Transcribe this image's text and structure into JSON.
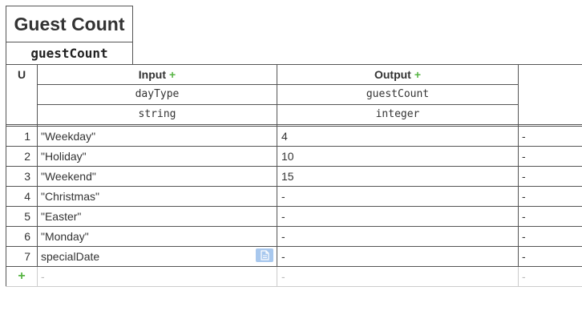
{
  "decision": {
    "name": "Guest Count",
    "variable": "guestCount"
  },
  "table": {
    "hit_policy": "U",
    "input": {
      "label": "Input",
      "add_icon": "plus-icon",
      "expression": "dayType",
      "type": "string"
    },
    "output": {
      "label": "Output",
      "add_icon": "plus-icon",
      "name": "guestCount",
      "type": "integer"
    },
    "rows": [
      {
        "num": "1",
        "input": "\"Weekday\"",
        "output": "4",
        "annotation": "-"
      },
      {
        "num": "2",
        "input": "\"Holiday\"",
        "output": "10",
        "annotation": "-"
      },
      {
        "num": "3",
        "input": "\"Weekend\"",
        "output": "15",
        "annotation": "-"
      },
      {
        "num": "4",
        "input": "\"Christmas\"",
        "output": "-",
        "annotation": "-"
      },
      {
        "num": "5",
        "input": "\"Easter\"",
        "output": "-",
        "annotation": "-"
      },
      {
        "num": "6",
        "input": "\"Monday\"",
        "output": "-",
        "annotation": "-"
      },
      {
        "num": "7",
        "input": "specialDate",
        "input_icon": "document-icon",
        "output": "-",
        "annotation": "-"
      }
    ],
    "add_row": {
      "label": "+",
      "input": "-",
      "output": "-",
      "annotation": "-"
    }
  },
  "colors": {
    "border": "#555555",
    "add": "#58b545",
    "icon_bg": "#a8c8ee"
  }
}
